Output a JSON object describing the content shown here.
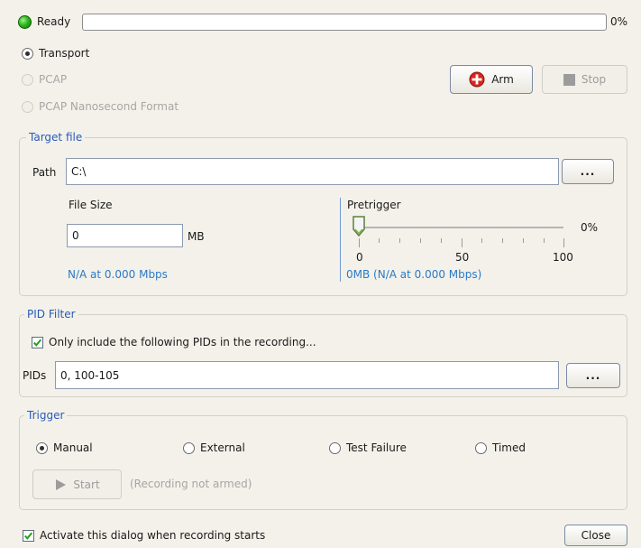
{
  "status": {
    "label": "Ready",
    "percent_text": "0%",
    "progress": 0
  },
  "capture_format": {
    "options": [
      {
        "label": "Transport",
        "selected": true,
        "enabled": true
      },
      {
        "label": "PCAP",
        "selected": false,
        "enabled": false
      },
      {
        "label": "PCAP Nanosecond Format",
        "selected": false,
        "enabled": false
      }
    ]
  },
  "buttons": {
    "arm": "Arm",
    "stop": "Stop",
    "start": "Start",
    "close": "Close",
    "browse": "..."
  },
  "target_file": {
    "legend": "Target file",
    "path_label": "Path",
    "path_value": "C:\\",
    "file_size_label": "File Size",
    "file_size_value": "0",
    "file_size_unit": "MB",
    "rate_text": "N/A at 0.000 Mbps",
    "pretrigger": {
      "label": "Pretrigger",
      "value_percent": 0,
      "value_text": "0%",
      "scale": [
        "0",
        "50",
        "100"
      ],
      "rate_text": "0MB (N/A at 0.000 Mbps)"
    }
  },
  "pid_filter": {
    "legend": "PID Filter",
    "only_include_label": "Only include the following PIDs in the recording...",
    "only_include_checked": true,
    "pids_label": "PIDs",
    "pids_value": "0, 100-105"
  },
  "trigger": {
    "legend": "Trigger",
    "options": [
      {
        "label": "Manual",
        "selected": true
      },
      {
        "label": "External",
        "selected": false
      },
      {
        "label": "Test Failure",
        "selected": false
      },
      {
        "label": "Timed",
        "selected": false
      }
    ],
    "armed_note": "(Recording not armed)"
  },
  "footer": {
    "activate_label": "Activate this dialog when recording starts",
    "activate_checked": true
  },
  "colors": {
    "accent_blue": "#2a5bb7",
    "ready_led": "#2fb51c",
    "arm_icon": "#d8261e"
  }
}
